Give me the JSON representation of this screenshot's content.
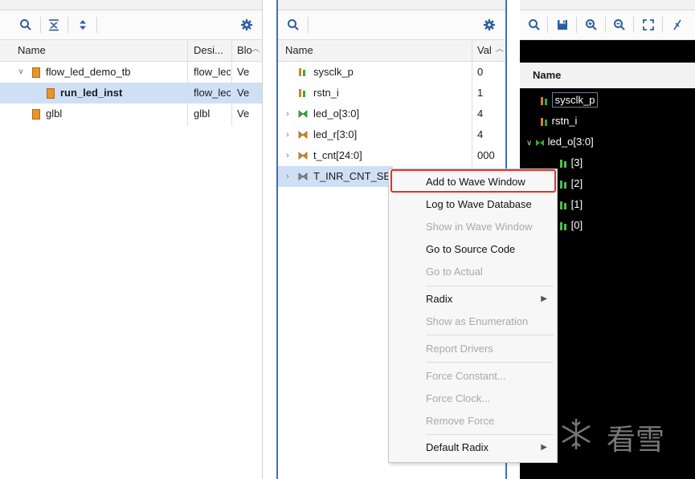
{
  "scope_panel": {
    "columns": [
      "Name",
      "Desi...",
      "Blo"
    ],
    "rows": [
      {
        "name": "flow_led_demo_tb",
        "design": "flow_lec",
        "block": "Ve",
        "expanded": true,
        "selected": false,
        "bold": false
      },
      {
        "name": "run_led_inst",
        "design": "flow_lec",
        "block": "Ve",
        "expanded": false,
        "selected": true,
        "bold": true
      },
      {
        "name": "glbl",
        "design": "glbl",
        "block": "Ve",
        "expanded": false,
        "selected": false,
        "bold": false
      }
    ]
  },
  "objects_panel": {
    "columns": [
      "Name",
      "Val"
    ],
    "rows": [
      {
        "name": "sysclk_p",
        "value": "0",
        "expandable": false,
        "icon": "signal-icon"
      },
      {
        "name": "rstn_i",
        "value": "1",
        "expandable": false,
        "icon": "signal-icon"
      },
      {
        "name": "led_o[3:0]",
        "value": "4",
        "expandable": true,
        "icon": "bus-icon"
      },
      {
        "name": "led_r[3:0]",
        "value": "4",
        "expandable": true,
        "icon": "bus-icon"
      },
      {
        "name": "t_cnt[24:0]",
        "value": "000",
        "expandable": true,
        "icon": "bus-icon"
      },
      {
        "name": "T_INR_CNT_SE",
        "value": "",
        "expandable": true,
        "icon": "bus-icon",
        "selected": true
      }
    ]
  },
  "wave_panel": {
    "header": "Name",
    "signals": [
      {
        "label": "sysclk_p",
        "indent": 0,
        "selected": true
      },
      {
        "label": "rstn_i",
        "indent": 0
      },
      {
        "label": "led_o[3:0]",
        "indent": 0,
        "group": true
      },
      {
        "label": "[3]",
        "indent": 1
      },
      {
        "label": "[2]",
        "indent": 1
      },
      {
        "label": "[1]",
        "indent": 1
      },
      {
        "label": "[0]",
        "indent": 1
      }
    ],
    "watermark_text": "看雪"
  },
  "context_menu": {
    "items": [
      {
        "label": "Add to Wave Window",
        "enabled": true,
        "highlighted": true
      },
      {
        "label": "Log to Wave Database",
        "enabled": true
      },
      {
        "label": "Show in Wave Window",
        "enabled": false
      },
      {
        "label": "Go to Source Code",
        "enabled": true
      },
      {
        "label": "Go to Actual",
        "enabled": false
      },
      {
        "label": "Radix",
        "enabled": true,
        "submenu": true
      },
      {
        "label": "Show as Enumeration",
        "enabled": false
      },
      {
        "label": "Report Drivers",
        "enabled": false
      },
      {
        "label": "Force Constant...",
        "enabled": false
      },
      {
        "label": "Force Clock...",
        "enabled": false
      },
      {
        "label": "Remove Force",
        "enabled": false
      },
      {
        "label": "Default Radix",
        "enabled": true,
        "submenu": true
      }
    ]
  },
  "colors": {
    "accent_blue": "#3d6fc6",
    "selection": "#cfe0f6",
    "highlight_red": "#e0342b",
    "scope_icon": "#e8952b",
    "wave_bg": "#000000",
    "signal_green": "#4fbf4f"
  }
}
